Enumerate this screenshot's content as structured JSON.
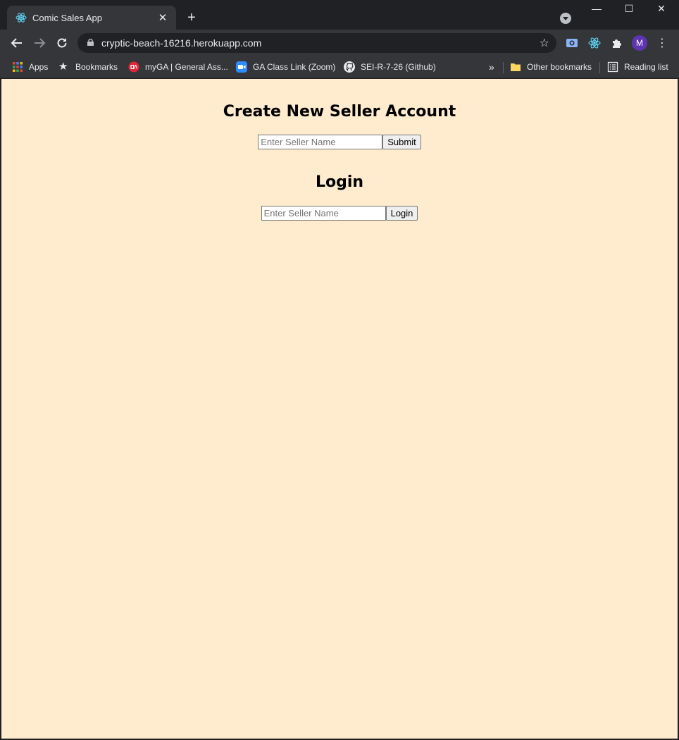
{
  "browser": {
    "tab_title": "Comic Sales App",
    "new_tab_glyph": "+",
    "url": "cryptic-beach-16216.herokuapp.com",
    "profile_initial": "M",
    "window_controls": {
      "minimize": "—",
      "maximize": "☐",
      "close": "✕"
    }
  },
  "bookmarks": {
    "items": [
      {
        "label": "Apps",
        "icon": "apps-grid-icon"
      },
      {
        "label": "Bookmarks",
        "icon": "star-icon"
      },
      {
        "label": "myGA | General Ass...",
        "icon": "ga-icon"
      },
      {
        "label": "GA Class Link (Zoom)",
        "icon": "zoom-icon"
      },
      {
        "label": "SEI-R-7-26 (Github)",
        "icon": "github-icon"
      }
    ],
    "overflow": "»",
    "other": "Other bookmarks",
    "reading_list": "Reading list"
  },
  "page": {
    "background": "#ffebcd",
    "create": {
      "heading": "Create New Seller Account",
      "input_placeholder": "Enter Seller Name",
      "input_value": "",
      "button_label": "Submit"
    },
    "login": {
      "heading": "Login",
      "input_placeholder": "Enter Seller Name",
      "input_value": "",
      "button_label": "Login"
    }
  }
}
